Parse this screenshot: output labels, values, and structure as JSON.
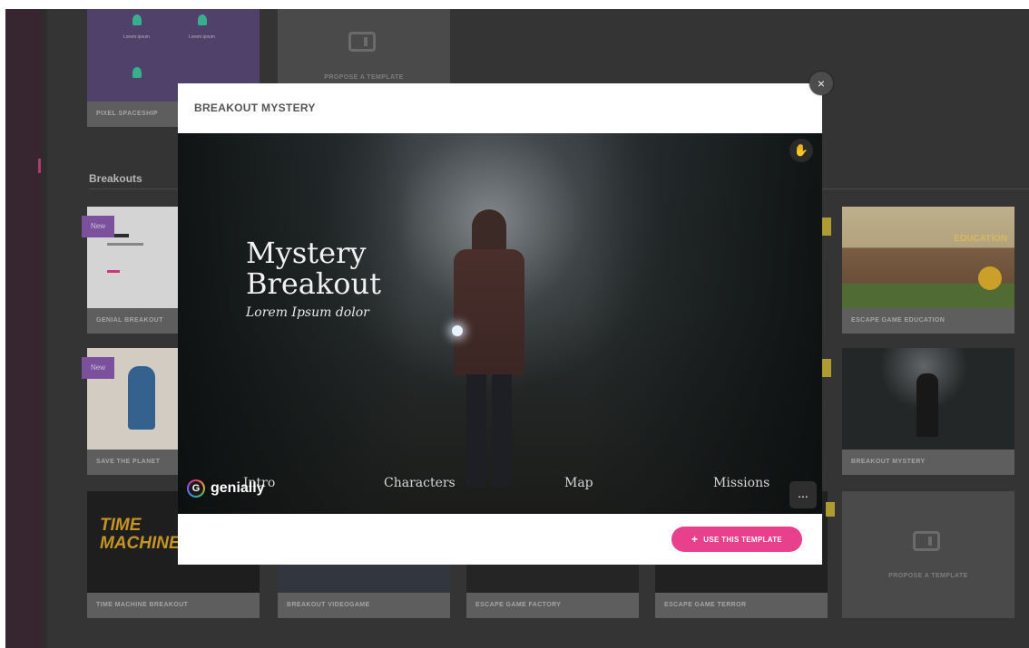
{
  "sidebar": {
    "items": []
  },
  "gallery": {
    "section_title": "Breakouts",
    "top_row": [
      {
        "label": "PIXEL SPACESHIP"
      },
      {
        "label": "PROPOSE A TEMPLATE"
      }
    ],
    "top_thumb_text": "Lorem ipsum",
    "cards_left": [
      {
        "label": "GENIAL BREAKOUT",
        "badge": "New"
      },
      {
        "label": "SAVE THE PLANET",
        "badge": "New"
      },
      {
        "label": "TIME MACHINE BREAKOUT",
        "thumb_text": "TIME MACHINE"
      }
    ],
    "cards_bottom": [
      {
        "label": "BREAKOUT VIDEOGAME"
      },
      {
        "label": "ESCAPE GAME FACTORY"
      },
      {
        "label": "ESCAPE GAME TERROR"
      }
    ],
    "cards_right": [
      {
        "label": "ESCAPE GAME EDUCATION",
        "thumb_text": "EDUCATION"
      },
      {
        "label": "BREAKOUT MYSTERY"
      }
    ],
    "propose_label": "PROPOSE A TEMPLATE"
  },
  "modal": {
    "title": "BREAKOUT MYSTERY",
    "close_label": "×",
    "preview": {
      "title": "Mystery Breakout",
      "subtitle": "Lorem Ipsum dolor",
      "nav": [
        "Intro",
        "Characters",
        "Map",
        "Missions"
      ],
      "logo_text": "genially",
      "more_label": "...",
      "hand_icon": "✋"
    },
    "use_button": {
      "icon": "+",
      "label": "USE THIS TEMPLATE"
    }
  },
  "colors": {
    "accent": "#e8408c",
    "new_badge": "#8c5cb3",
    "sidebar": "#3f2b37"
  }
}
